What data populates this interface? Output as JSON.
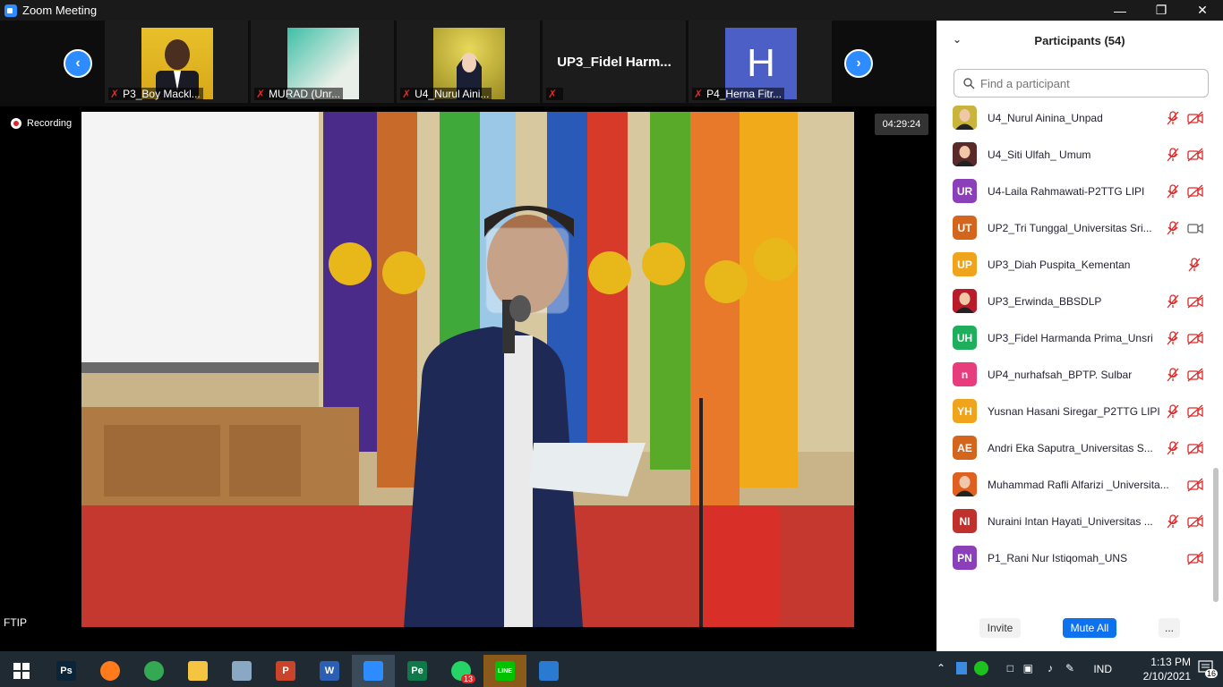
{
  "window": {
    "title": "Zoom Meeting"
  },
  "stage": {
    "recording_label": "Recording",
    "timer": "04:29:24",
    "speaker_label": "FTIP",
    "gallery": [
      {
        "name": "P3_Boy Mackl...",
        "bg": "#e8c02a"
      },
      {
        "name": "MURAD (Unr...",
        "bg": "#3dbfa6"
      },
      {
        "name": "U4_Nurul Aini...",
        "bg": "#d8c240"
      },
      {
        "name": "",
        "bigname": "UP3_Fidel  Harm..."
      },
      {
        "name": "P4_Herna Fitr...",
        "letter": "H",
        "bg": "#4c5fc7"
      }
    ]
  },
  "participants": {
    "title": "Participants (54)",
    "search_placeholder": "Find a participant",
    "list": [
      {
        "name": "U4_Nurul Ainina_Unpad",
        "initials": "",
        "color": "#c9b43c",
        "photo": true
      },
      {
        "name": "U4_Siti Ulfah_ Umum",
        "initials": "",
        "color": "#5a2a2a",
        "photo": true
      },
      {
        "name": "U4-Laila Rahmawati-P2TTG LIPI",
        "initials": "UR",
        "color": "#8b3fb8"
      },
      {
        "name": "UP2_Tri Tunggal_Universitas Sri...",
        "initials": "UT",
        "color": "#d4651c",
        "cam_on": true
      },
      {
        "name": "UP3_Diah Puspita_Kementan",
        "initials": "UP",
        "color": "#f0a41c",
        "no_cam": true
      },
      {
        "name": "UP3_Erwinda_BBSDLP",
        "initials": "",
        "color": "#b81c2a",
        "photo": true
      },
      {
        "name": "UP3_Fidel Harmanda Prima_Unsri",
        "initials": "UH",
        "color": "#1fae5c"
      },
      {
        "name": "UP4_nurhafsah_BPTP. Sulbar",
        "initials": "n",
        "color": "#e83d7c"
      },
      {
        "name": "Yusnan Hasani Siregar_P2TTG LIPI",
        "initials": "YH",
        "color": "#f0a41c"
      },
      {
        "name": "Andri Eka Saputra_Universitas S...",
        "initials": "AE",
        "color": "#d4651c"
      },
      {
        "name": "Muhammad Rafli Alfarizi _Universita...",
        "initials": "",
        "color": "#e06020",
        "photo": true,
        "no_mic": true
      },
      {
        "name": "Nuraini Intan Hayati_Universitas ...",
        "initials": "NI",
        "color": "#c0302c"
      },
      {
        "name": "P1_Rani Nur Istiqomah_UNS",
        "initials": "PN",
        "color": "#8b3fb8",
        "no_mic": true
      }
    ],
    "invite_label": "Invite",
    "mute_all_label": "Mute All",
    "more_label": "..."
  },
  "taskbar": {
    "apps": [
      {
        "name": "photoshop",
        "label": "Ps",
        "color": "#0b2438"
      },
      {
        "name": "firefox",
        "label": "",
        "color": "#ff7b1c"
      },
      {
        "name": "chrome",
        "label": "",
        "color": "#34a853"
      },
      {
        "name": "file-explorer",
        "label": "",
        "color": "#f5c542"
      },
      {
        "name": "photos-viewer",
        "label": "",
        "color": "#8aa7c4"
      },
      {
        "name": "powerpoint",
        "label": "P",
        "color": "#c8452c"
      },
      {
        "name": "word",
        "label": "W",
        "color": "#2b5fb4"
      },
      {
        "name": "zoom",
        "label": "",
        "color": "#2d8cff"
      },
      {
        "name": "publisher",
        "label": "Pe",
        "color": "#0e7a4a"
      },
      {
        "name": "whatsapp",
        "label": "",
        "color": "#25d366",
        "badge": "13"
      },
      {
        "name": "line",
        "label": "LINE",
        "color": "#00c300"
      },
      {
        "name": "photos",
        "label": "",
        "color": "#2a7ad1"
      }
    ],
    "language": "IND",
    "time": "1:13 PM",
    "date": "2/10/2021",
    "notification_count": "16"
  }
}
